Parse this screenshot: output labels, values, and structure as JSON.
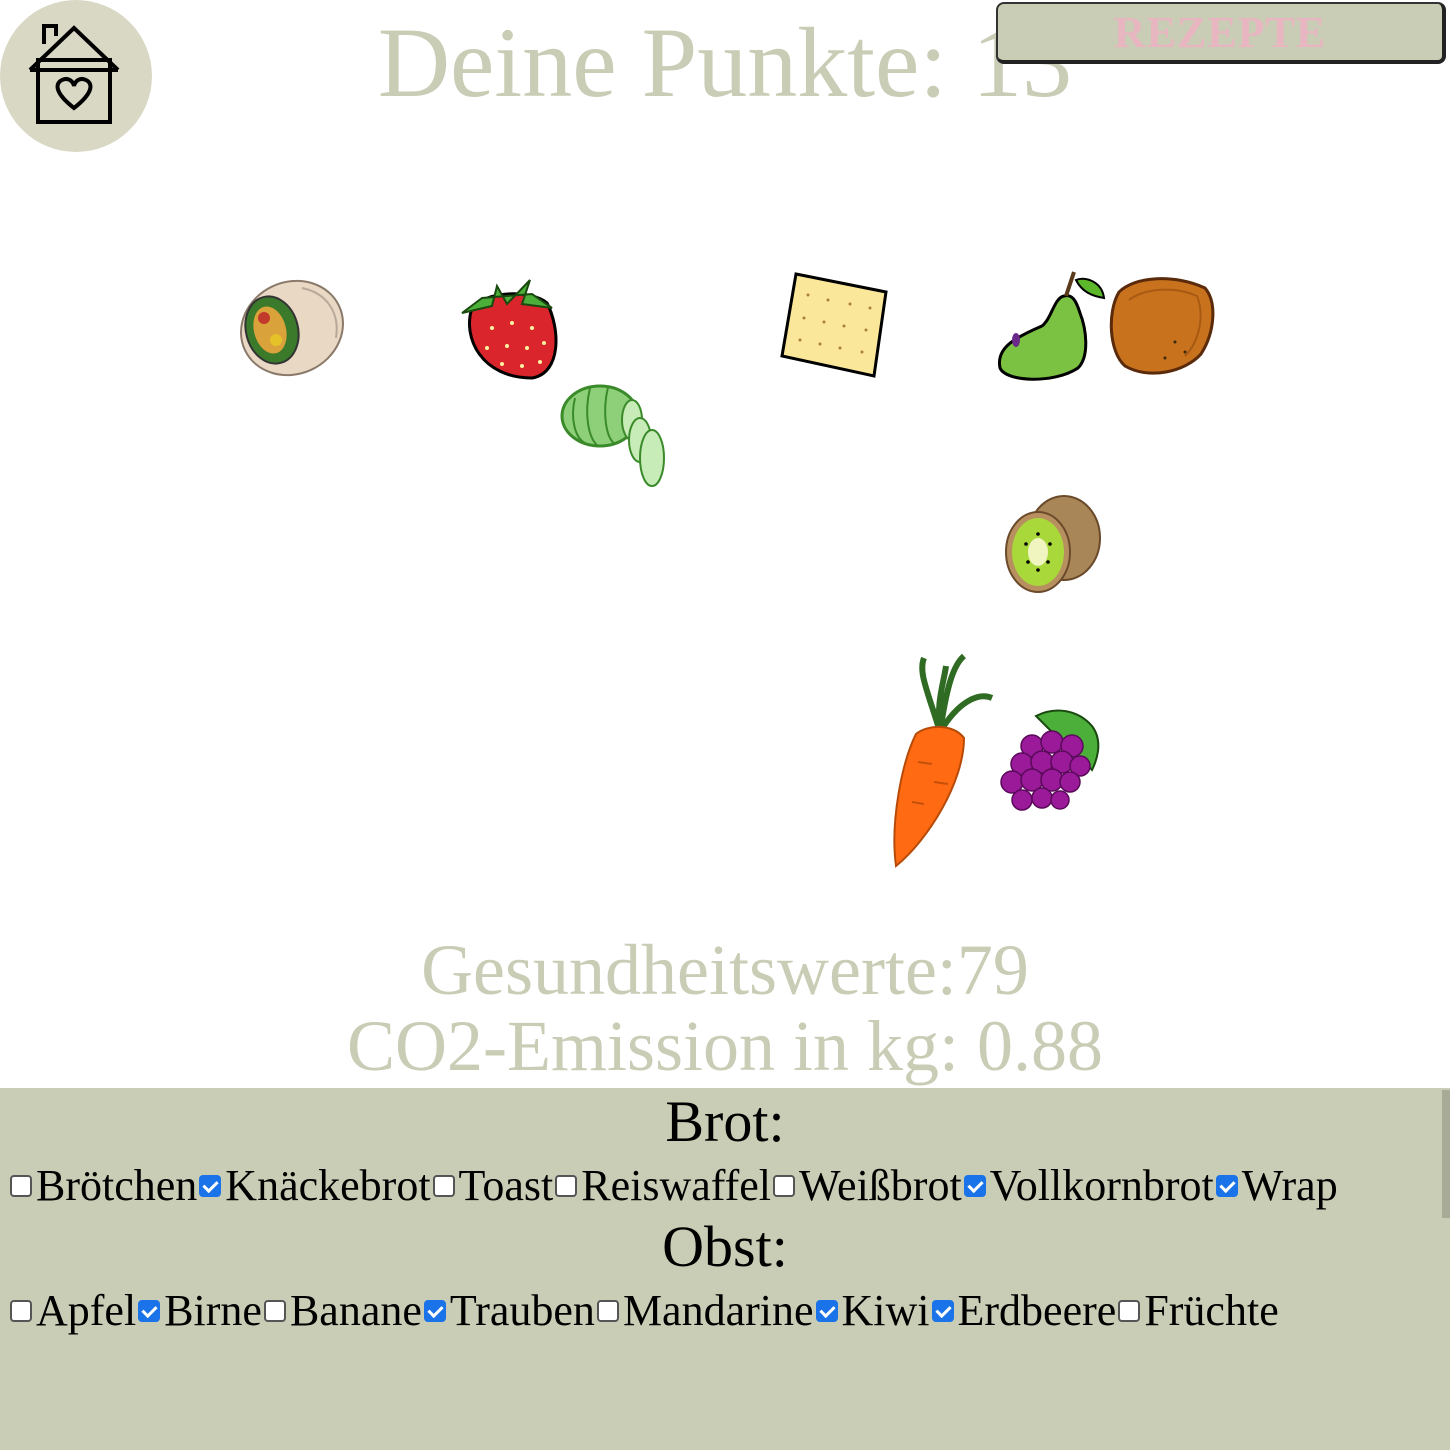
{
  "header": {
    "score_text": "Deine Punkte: 13",
    "rezepte_label": "REZEPTE"
  },
  "icons": {
    "home": "house-heart-icon"
  },
  "stats": {
    "health": "Gesundheitswerte:79",
    "co2": "CO2-Emission in kg: 0.88"
  },
  "colors": {
    "accent": "#c9cdb5",
    "home_bg": "#d9d8c4",
    "rezepte_text": "#e8b6c0",
    "checkbox_checked": "#1a73e8"
  },
  "plate_items": [
    "wrap",
    "strawberry",
    "cucumber",
    "crispbread",
    "pear",
    "wholegrain-bread",
    "kiwi",
    "carrot",
    "grapes"
  ],
  "categories": [
    {
      "title": "Brot:",
      "options": [
        {
          "label": "Brötchen",
          "checked": false
        },
        {
          "label": "Knäckebrot",
          "checked": true
        },
        {
          "label": "Toast",
          "checked": false
        },
        {
          "label": "Reiswaffel",
          "checked": false
        },
        {
          "label": "Weißbrot",
          "checked": false
        },
        {
          "label": "Vollkornbrot",
          "checked": true
        },
        {
          "label": "Wrap",
          "checked": true
        }
      ]
    },
    {
      "title": "Obst:",
      "options": [
        {
          "label": "Apfel",
          "checked": false
        },
        {
          "label": "Birne",
          "checked": true
        },
        {
          "label": "Banane",
          "checked": false
        },
        {
          "label": "Trauben",
          "checked": true
        },
        {
          "label": "Mandarine",
          "checked": false
        },
        {
          "label": "Kiwi",
          "checked": true
        },
        {
          "label": "Erdbeere",
          "checked": true
        },
        {
          "label": "Früchte",
          "checked": false
        }
      ]
    }
  ]
}
